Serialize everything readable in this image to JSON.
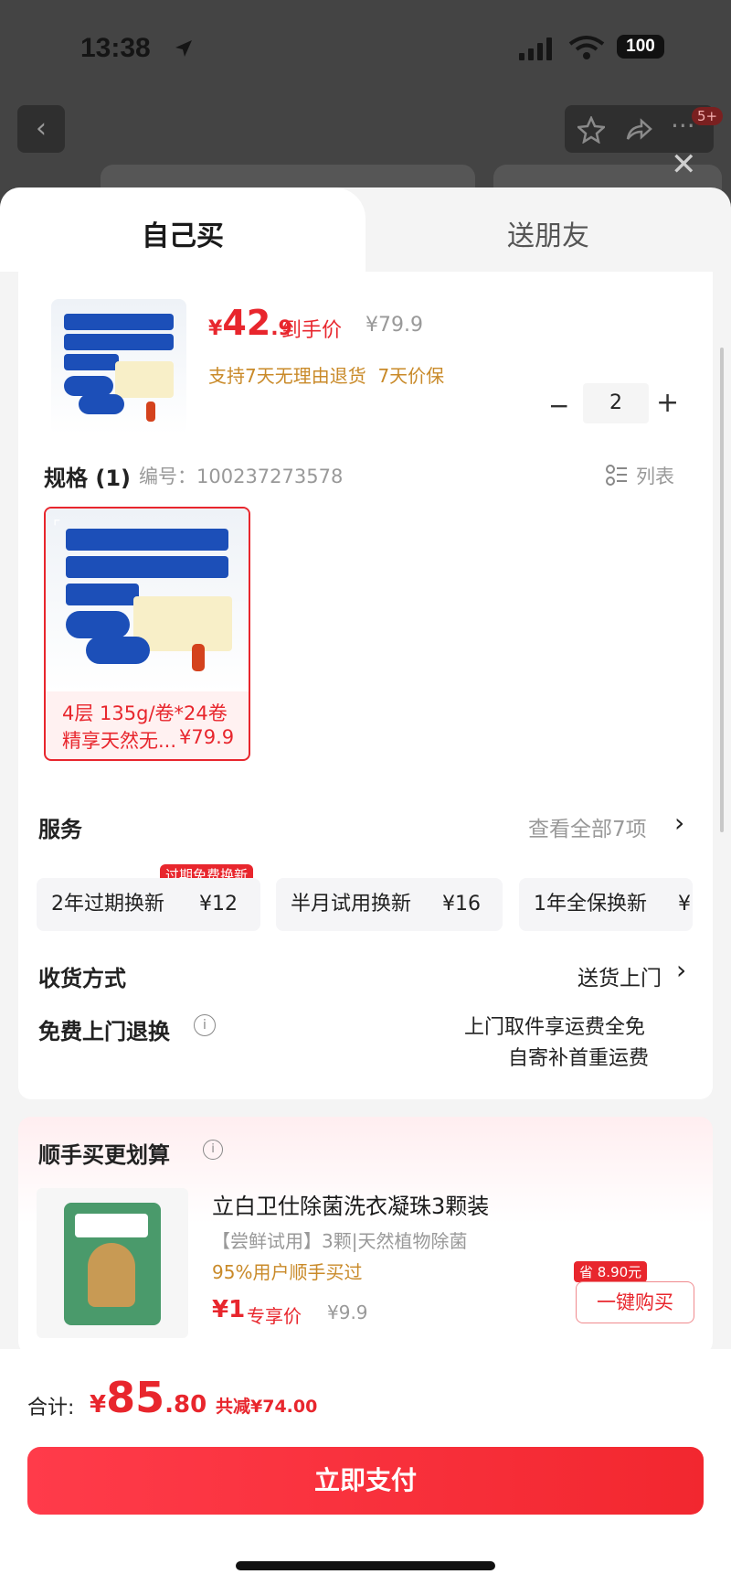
{
  "status_bar": {
    "time": "13:38",
    "battery": "100"
  },
  "top_badge": "5+",
  "tabs": [
    "自己买",
    "送朋友"
  ],
  "product": {
    "price_symbol": "¥",
    "price_int": "42",
    "price_dec": ".9",
    "price_label": "到手价",
    "orig_price": "¥79.9",
    "guarantee": "支持7天无理由退货  7天价保",
    "quantity": "2",
    "minus": "−",
    "plus": "+"
  },
  "spec": {
    "title": "规格 (1)",
    "sku": "编号：100237273578",
    "list_label": "列表",
    "item_line1": "4层 135g/卷*24卷",
    "item_line2": "精享天然无...",
    "item_price": "¥79.9"
  },
  "service": {
    "title": "服务",
    "view_all": "查看全部7项",
    "badge": "过期免费换新",
    "options": [
      {
        "name": "2年过期换新",
        "price": "¥12"
      },
      {
        "name": "半月试用换新",
        "price": "¥16"
      },
      {
        "name": "1年全保换新",
        "price": "¥"
      }
    ]
  },
  "delivery": {
    "label": "收货方式",
    "value": "送货上门"
  },
  "free_return": {
    "label": "免费上门退换",
    "line1": "上门取件享运费全免",
    "line2": "自寄补首重运费"
  },
  "addon": {
    "title": "顺手买更划算",
    "product_name": "立白卫仕除菌洗衣凝珠3颗装",
    "desc": "【尝鲜试用】3颗|天然植物除菌",
    "social": "95%用户顺手买过",
    "price": "¥1",
    "price_label": "专享价",
    "orig_price": "¥9.9",
    "save_badge": "省 8.90元",
    "buy_button": "一键购买"
  },
  "footer": {
    "total_label": "合计:",
    "total_symbol": "¥",
    "total_int": "85",
    "total_dec": ".80",
    "discount": "共减¥74.00",
    "pay_button": "立即支付"
  },
  "colors": {
    "accent": "#e8262d",
    "gold": "#c98a29"
  }
}
